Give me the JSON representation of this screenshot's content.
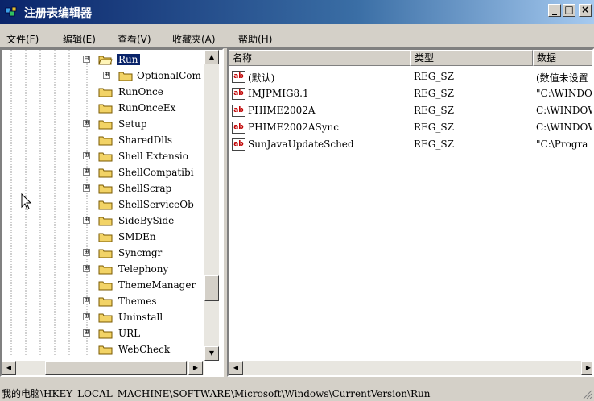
{
  "window": {
    "title": "注册表编辑器",
    "minimize": "_",
    "maximize": "□",
    "close": "×"
  },
  "menu": [
    {
      "label": "文件(F)"
    },
    {
      "label": "编辑(E)"
    },
    {
      "label": "查看(V)"
    },
    {
      "label": "收藏夹(A)"
    },
    {
      "label": "帮助(H)"
    }
  ],
  "tree": [
    {
      "label": "Run",
      "expander": "⊟",
      "selected": true,
      "open": true
    },
    {
      "label": "OptionalCom",
      "expander": "⊞"
    },
    {
      "label": "RunOnce",
      "expander": ""
    },
    {
      "label": "RunOnceEx",
      "expander": ""
    },
    {
      "label": "Setup",
      "expander": "⊞"
    },
    {
      "label": "SharedDlls",
      "expander": ""
    },
    {
      "label": "Shell Extensio",
      "expander": "⊞"
    },
    {
      "label": "ShellCompatibi",
      "expander": "⊞"
    },
    {
      "label": "ShellScrap",
      "expander": "⊞"
    },
    {
      "label": "ShellServiceOb",
      "expander": ""
    },
    {
      "label": "SideBySide",
      "expander": "⊞"
    },
    {
      "label": "SMDEn",
      "expander": ""
    },
    {
      "label": "Syncmgr",
      "expander": "⊞"
    },
    {
      "label": "Telephony",
      "expander": "⊞"
    },
    {
      "label": "ThemeManager",
      "expander": ""
    },
    {
      "label": "Themes",
      "expander": "⊞"
    },
    {
      "label": "Uninstall",
      "expander": "⊞"
    },
    {
      "label": "URL",
      "expander": "⊞"
    },
    {
      "label": "WebCheck",
      "expander": ""
    }
  ],
  "columns": {
    "name": "名称",
    "type": "类型",
    "data": "数据"
  },
  "values": [
    {
      "name": "(默认)",
      "type": "REG_SZ",
      "data": "(数值未设置"
    },
    {
      "name": "IMJPMIG8.1",
      "type": "REG_SZ",
      "data": "\"C:\\WINDOW"
    },
    {
      "name": "PHIME2002A",
      "type": "REG_SZ",
      "data": "C:\\WINDOWS"
    },
    {
      "name": "PHIME2002ASync",
      "type": "REG_SZ",
      "data": "C:\\WINDOWS"
    },
    {
      "name": "SunJavaUpdateSched",
      "type": "REG_SZ",
      "data": "\"C:\\Progra"
    }
  ],
  "status": {
    "path": "我的电脑\\HKEY_LOCAL_MACHINE\\SOFTWARE\\Microsoft\\Windows\\CurrentVersion\\Run"
  },
  "icons": {
    "value": "ab",
    "folder": "folder-icon"
  },
  "colors": {
    "titlebar": "#0a246a",
    "selection": "#0a246a",
    "folder": "#f2d366",
    "chrome": "#d4d0c8"
  }
}
